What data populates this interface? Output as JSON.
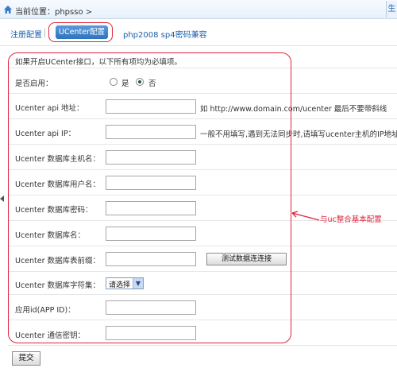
{
  "breadcrumb": {
    "text": "当前位置：phpsso >"
  },
  "corner": {
    "label": "生"
  },
  "tabs": [
    {
      "label": "注册配置"
    },
    {
      "label": "UCenter配置",
      "active": true
    },
    {
      "label": "php2008 sp4密码兼容"
    }
  ],
  "form": {
    "intro": "如果开启UCenter接口，以下所有项均为必填项。",
    "enable": {
      "label": "是否启用：",
      "options": [
        {
          "label": "是",
          "checked": false
        },
        {
          "label": "否",
          "checked": true
        }
      ]
    },
    "fields": [
      {
        "label": "Ucenter api 地址：",
        "value": "",
        "note": "如  http://www.domain.com/ucenter 最后不要带斜线"
      },
      {
        "label": "Ucenter api IP：",
        "value": "",
        "note": "一般不用填写,遇到无法同步时,请填写ucenter主机的IP地址"
      },
      {
        "label": "Ucenter 数据库主机名：",
        "value": ""
      },
      {
        "label": "Ucenter 数据库用户名：",
        "value": ""
      },
      {
        "label": "Ucenter 数据库密码：",
        "value": ""
      },
      {
        "label": "Ucenter 数据库名：",
        "value": ""
      },
      {
        "label": "Ucenter 数据库表前缀：",
        "value": ""
      }
    ],
    "test_button": "测试数据连连接",
    "charset": {
      "label": "Ucenter 数据库字符集：",
      "selected": "请选择"
    },
    "appid": {
      "label": "应用id(APP ID)：",
      "value": ""
    },
    "key": {
      "label": "Ucenter 通信密钥：",
      "value": ""
    }
  },
  "annotation": {
    "text": "与uc整合基本配置",
    "color": "#e0233e"
  },
  "submit": {
    "label": "提交"
  },
  "colors": {
    "accent": "#2f73bf",
    "link": "#1a5fad",
    "annotation": "#e0233e"
  }
}
